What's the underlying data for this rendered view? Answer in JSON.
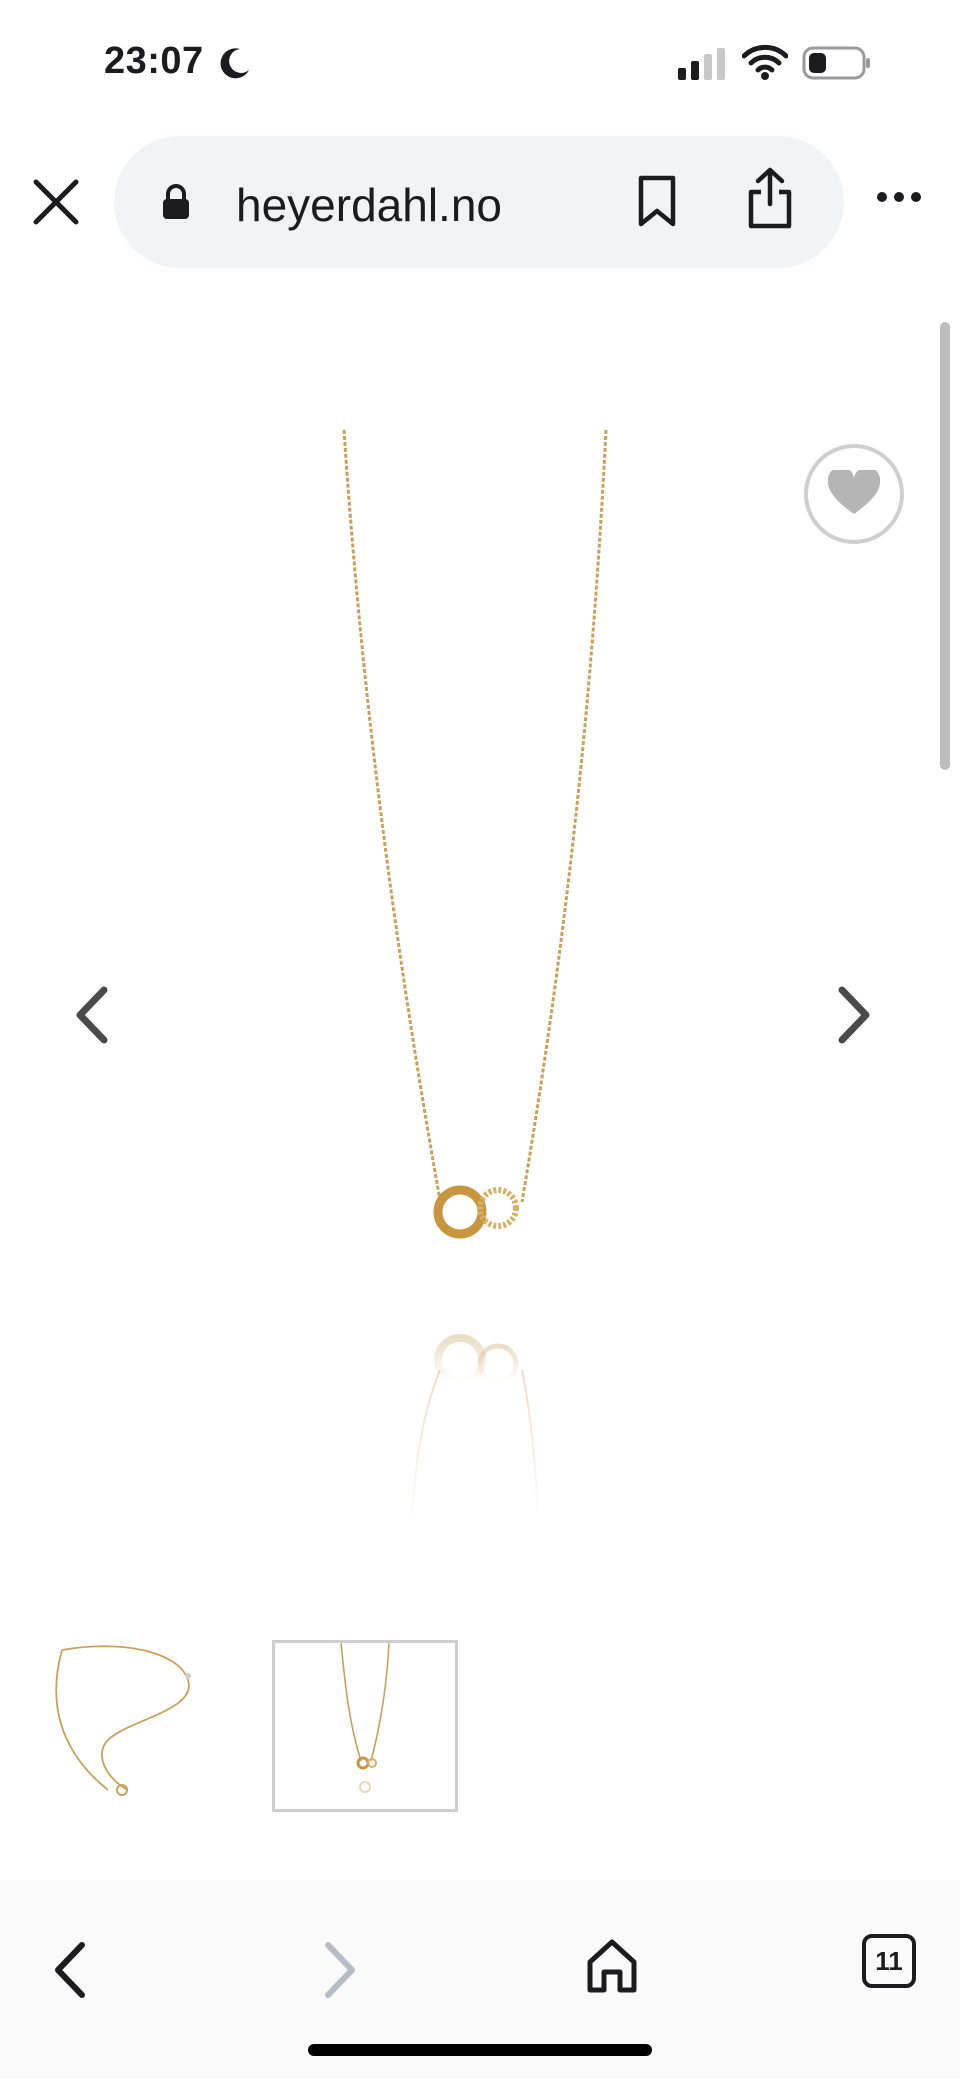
{
  "status_bar": {
    "time": "23:07"
  },
  "browser": {
    "url": "heyerdahl.no",
    "tab_count": "11"
  },
  "icons": {
    "close": "close-icon",
    "lock": "lock-icon",
    "bookmark": "bookmark-icon",
    "share": "share-icon",
    "more": "more-icon",
    "favorite": "heart-icon",
    "prev": "chevron-left-icon",
    "next": "chevron-right-icon",
    "back": "back-icon",
    "forward": "forward-icon",
    "home": "home-icon"
  },
  "colors": {
    "gold": "#c9a15c",
    "url_bar_bg": "#f2f3f5",
    "disabled": "#b8bcc4"
  }
}
